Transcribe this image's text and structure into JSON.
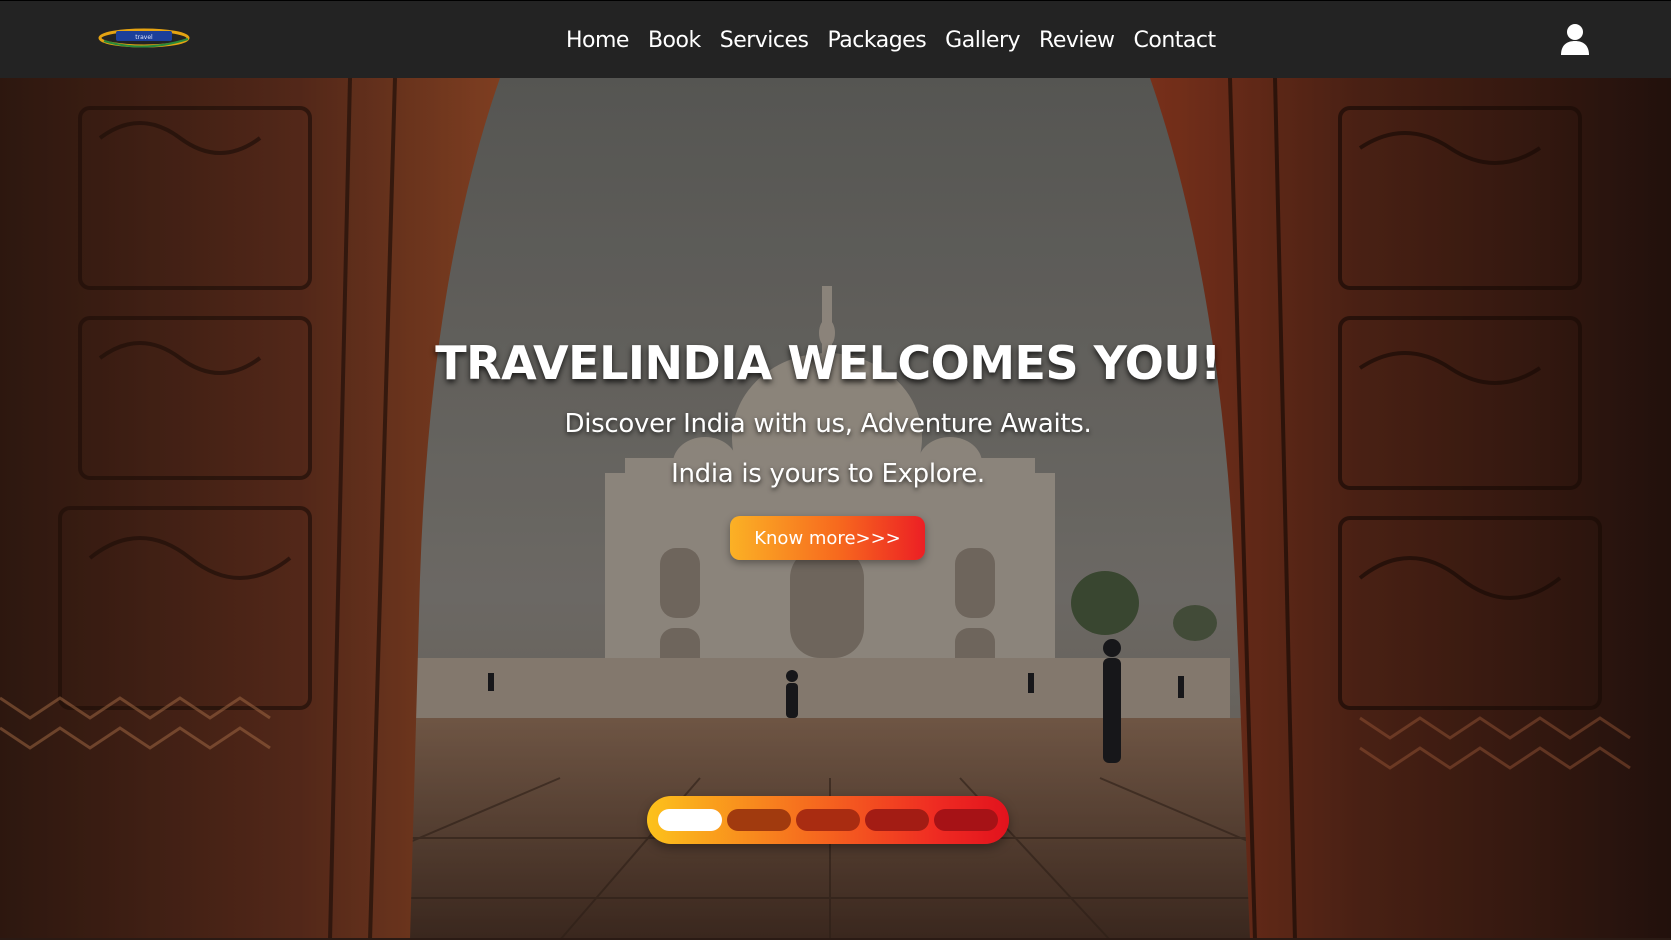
{
  "brand": {
    "logo_alt": "TravelIndia logo",
    "colors": {
      "accent_start": "#fbb125",
      "accent_end": "#ec1f24",
      "navbar_bg": "#232323"
    }
  },
  "nav": {
    "links": [
      {
        "label": "Home"
      },
      {
        "label": "Book"
      },
      {
        "label": "Services"
      },
      {
        "label": "Packages"
      },
      {
        "label": "Gallery"
      },
      {
        "label": "Review"
      },
      {
        "label": "Contact"
      }
    ],
    "user_icon": "user-icon"
  },
  "hero": {
    "title": "TRAVELINDIA WELCOMES YOU!",
    "subtitle1": "Discover India with us, Adventure Awaits.",
    "subtitle2": "India is yours to Explore.",
    "cta_label": "Know more>>>",
    "background": "Taj Mahal framed by carved red sandstone doorway",
    "slides": {
      "count": 5,
      "active_index": 0
    }
  }
}
